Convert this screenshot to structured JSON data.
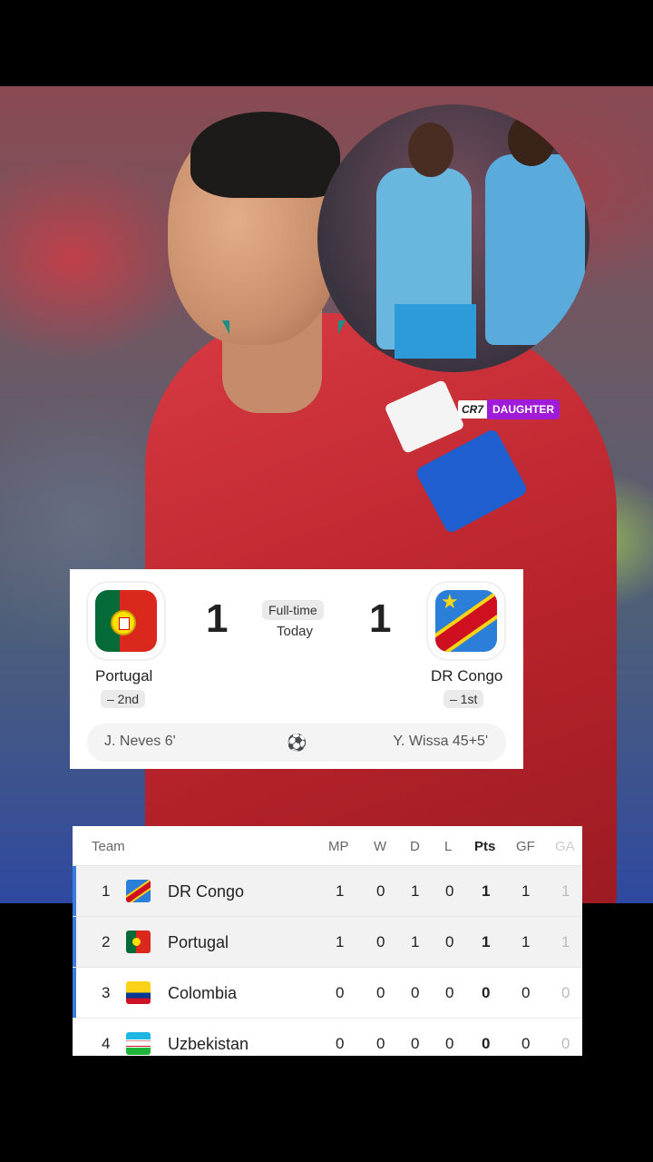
{
  "inset_tag": {
    "left": "CR7",
    "right": "DAUGHTER"
  },
  "match": {
    "status": "Full-time",
    "date": "Today",
    "home": {
      "name": "Portugal",
      "score": "1",
      "rank": "– 2nd",
      "scorer": "J. Neves 6'"
    },
    "away": {
      "name": "DR Congo",
      "score": "1",
      "rank": "– 1st",
      "scorer": "Y. Wissa 45+5'"
    },
    "goal_icon": "soccer-ball-icon"
  },
  "standings": {
    "headers": {
      "team": "Team",
      "mp": "MP",
      "w": "W",
      "d": "D",
      "l": "L",
      "pts": "Pts",
      "gf": "GF",
      "ga": "GA"
    },
    "rows": [
      {
        "pos": "1",
        "team": "DR Congo",
        "flag": "dr-congo-flag-icon",
        "mp": "1",
        "w": "0",
        "d": "1",
        "l": "0",
        "pts": "1",
        "gf": "1",
        "ga": "1"
      },
      {
        "pos": "2",
        "team": "Portugal",
        "flag": "portugal-flag-icon",
        "mp": "1",
        "w": "0",
        "d": "1",
        "l": "0",
        "pts": "1",
        "gf": "1",
        "ga": "1"
      },
      {
        "pos": "3",
        "team": "Colombia",
        "flag": "colombia-flag-icon",
        "mp": "0",
        "w": "0",
        "d": "0",
        "l": "0",
        "pts": "0",
        "gf": "0",
        "ga": "0"
      },
      {
        "pos": "4",
        "team": "Uzbekistan",
        "flag": "uzbekistan-flag-icon",
        "mp": "0",
        "w": "0",
        "d": "0",
        "l": "0",
        "pts": "0",
        "gf": "0",
        "ga": "0"
      }
    ]
  },
  "colors": {
    "accent": "#3a7be0",
    "tag_purple": "#a01bd8",
    "portugal_red": "#da291c",
    "congo_blue": "#2b7fd8"
  }
}
